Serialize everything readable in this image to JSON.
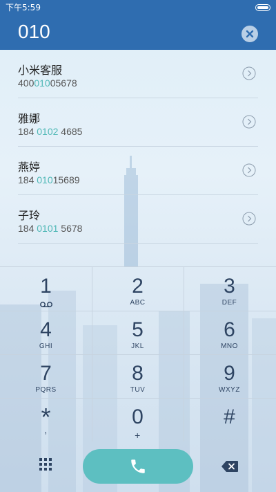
{
  "status_bar": {
    "time": "下午5:59"
  },
  "dialer": {
    "input_number": "010"
  },
  "results": [
    {
      "name": "小米客服",
      "number_before": "400",
      "number_match": "010",
      "number_after": "05678"
    },
    {
      "name": "雅娜",
      "number_before": "184 ",
      "number_match": "0102",
      "number_after": " 4685"
    },
    {
      "name": "燕婷",
      "number_before": "184 ",
      "number_match": "010",
      "number_after": "15689"
    },
    {
      "name": "子玲",
      "number_before": "184 ",
      "number_match": "0101",
      "number_after": " 5678"
    }
  ],
  "keypad": [
    {
      "digit": "1",
      "letters": ""
    },
    {
      "digit": "2",
      "letters": "ABC"
    },
    {
      "digit": "3",
      "letters": "DEF"
    },
    {
      "digit": "4",
      "letters": "GHI"
    },
    {
      "digit": "5",
      "letters": "JKL"
    },
    {
      "digit": "6",
      "letters": "MNO"
    },
    {
      "digit": "7",
      "letters": "PQRS"
    },
    {
      "digit": "8",
      "letters": "TUV"
    },
    {
      "digit": "9",
      "letters": "WXYZ"
    },
    {
      "digit": "*",
      "letters": ","
    },
    {
      "digit": "0",
      "letters": "+"
    },
    {
      "digit": "#",
      "letters": ""
    }
  ],
  "icons": {
    "voicemail": "voicemail-icon",
    "clear": "clear-icon",
    "chevron": "chevron-right-icon",
    "keypad_toggle": "grid-icon",
    "call": "phone-icon",
    "delete": "backspace-icon"
  },
  "colors": {
    "header": "#2f6db0",
    "match_highlight": "#4fb8b6",
    "call_button": "#5dbfc1",
    "keypad_text": "#2e4462"
  }
}
